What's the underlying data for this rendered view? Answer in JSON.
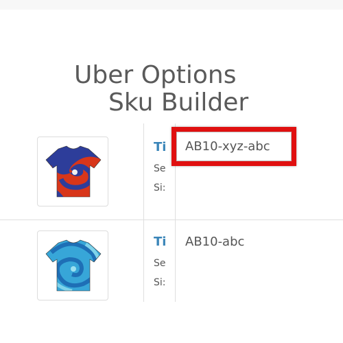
{
  "title": {
    "line1": "Uber Options",
    "line2": "Sku Builder"
  },
  "rows": [
    {
      "product_name": "Ti",
      "sub1": "Se",
      "sub2": "Si:",
      "sku": "AB10-xyz-abc",
      "image": "tie-dye-shirt-red-blue-icon"
    },
    {
      "product_name": "Ti",
      "sub1": "Se",
      "sub2": "Si:",
      "sku": "AB10-abc",
      "image": "tie-dye-shirt-blue-icon"
    }
  ],
  "colors": {
    "highlight": "#e01010",
    "link": "#3a85b8",
    "text": "#555555"
  }
}
